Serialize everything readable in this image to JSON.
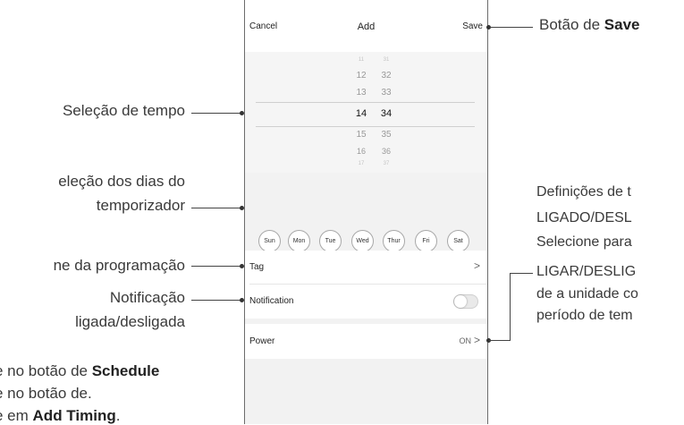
{
  "navbar": {
    "cancel": "Cancel",
    "title": "Add",
    "save": "Save"
  },
  "picker": {
    "hours": [
      "11",
      "12",
      "13",
      "14",
      "15",
      "16",
      "17"
    ],
    "minutes": [
      "31",
      "32",
      "33",
      "34",
      "35",
      "36",
      "37"
    ],
    "selected_hour": "14",
    "selected_minute": "34"
  },
  "days": [
    "Sun",
    "Mon",
    "Tue",
    "Wed",
    "Thur",
    "Fri",
    "Sat"
  ],
  "rows": {
    "tag": {
      "label": "Tag",
      "chevron": ">"
    },
    "notification": {
      "label": "Notification",
      "enabled": false
    },
    "power": {
      "label": "Power",
      "value": "ON",
      "chevron": ">"
    }
  },
  "callouts": {
    "save_prefix": "Botão de ",
    "save_bold": "Save",
    "time_selection": "Seleção de tempo",
    "days_line1": "eleção dos dias do",
    "days_line2": "temporizador",
    "name": "ne da programação",
    "notification_line1": "Notificação",
    "notification_line2": "ligada/desligada",
    "footer_line1_prefix": "e no botão de ",
    "footer_line1_bold": "Schedule",
    "footer_line2": "e no botão de.",
    "footer_line3_prefix": "e em ",
    "footer_line3_bold": "Add Timing",
    "footer_line3_suffix": ".",
    "right_line1": "Definições de t",
    "right_line2": "LIGADO/DESL",
    "right_line3": "Selecione para",
    "right_line4": "LIGAR/DESLIG",
    "right_line5": "de a unidade co",
    "right_line6": "período de tem"
  }
}
